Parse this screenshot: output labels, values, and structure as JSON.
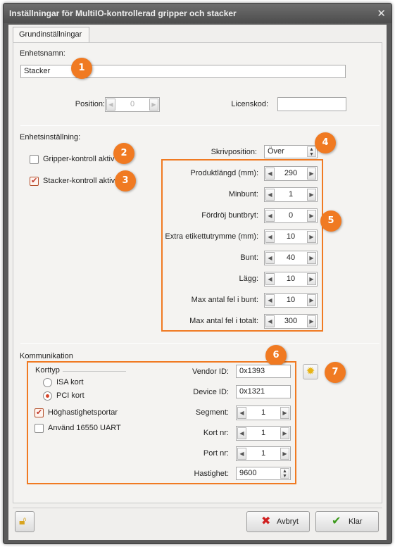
{
  "window": {
    "title": "Inställningar för MultiIO-kontrollerad gripper och stacker"
  },
  "tabs": [
    {
      "label": "Grundinställningar"
    }
  ],
  "unit": {
    "name_label": "Enhetsnamn:",
    "name_value": "Stacker",
    "position_label": "Position:",
    "position_value": "0",
    "license_label": "Licenskod:",
    "license_value": ""
  },
  "unit_setting": {
    "section_label": "Enhetsinställning:",
    "gripper_label": "Gripper-kontroll aktiv",
    "gripper_checked": false,
    "stacker_label": "Stacker-kontroll aktiv",
    "stacker_checked": true,
    "print_position_label": "Skrivposition:",
    "print_position_value": "Över",
    "fields": [
      {
        "label": "Produktlängd (mm):",
        "value": "290"
      },
      {
        "label": "Minbunt:",
        "value": "1"
      },
      {
        "label": "Fördröj buntbryt:",
        "value": "0"
      },
      {
        "label": "Extra etikettutrymme (mm):",
        "value": "10"
      },
      {
        "label": "Bunt:",
        "value": "40"
      },
      {
        "label": "Lägg:",
        "value": "10"
      },
      {
        "label": "Max antal fel i bunt:",
        "value": "10"
      },
      {
        "label": "Max antal fel i totalt:",
        "value": "300"
      }
    ]
  },
  "communication": {
    "section_label": "Kommunikation",
    "card_type_label": "Korttyp",
    "isa_label": "ISA kort",
    "pci_label": "PCI kort",
    "selected_card": "PCI kort",
    "high_speed_label": "Höghastighetsportar",
    "high_speed_checked": true,
    "uart_label": "Använd 16550 UART",
    "uart_checked": false,
    "vendor_label": "Vendor ID:",
    "vendor_value": "0x1393",
    "device_label": "Device ID:",
    "device_value": "0x1321",
    "segment_label": "Segment:",
    "segment_value": "1",
    "card_no_label": "Kort nr:",
    "card_no_value": "1",
    "port_no_label": "Port nr:",
    "port_no_value": "1",
    "speed_label": "Hastighet:",
    "speed_value": "9600"
  },
  "footer": {
    "cancel_label": "Avbryt",
    "ok_label": "Klar"
  },
  "callouts": [
    "1",
    "2",
    "3",
    "4",
    "5",
    "6",
    "7"
  ],
  "colors": {
    "accent": "#f07a22",
    "titlebar": "#5a5a5a",
    "panel": "#f4f3f1"
  }
}
